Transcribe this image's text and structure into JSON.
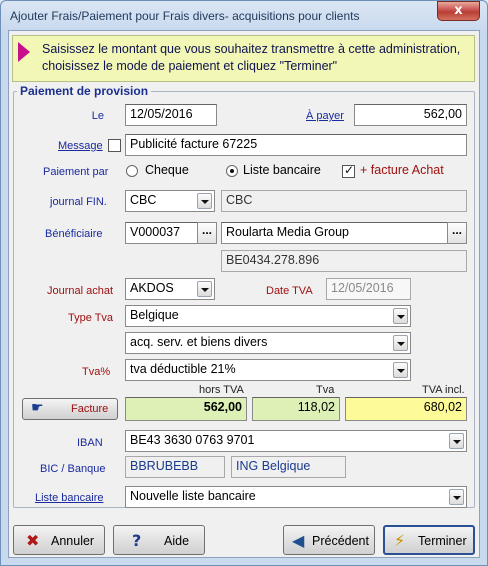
{
  "window": {
    "title": "Ajouter Frais/Paiement pour Frais divers- acquisitions pour clients",
    "close_glyph": "x"
  },
  "banner": {
    "text": "Saisissez le montant que vous souhaitez transmettre à cette administration, choisissez le mode de paiement et cliquez \"Terminer\""
  },
  "group": {
    "title": "Paiement de provision"
  },
  "form": {
    "le_label": "Le",
    "le_value": "12/05/2016",
    "a_payer_label": "À payer",
    "a_payer_value": "562,00",
    "message_label": "Message",
    "message_checked": false,
    "message_value": "Publicité facture 67225",
    "paiement_par_label": "Paiement par",
    "paiement_options": [
      "Cheque",
      "Liste bancaire"
    ],
    "paiement_selected": "Liste bancaire",
    "facture_achat_label": "+ facture Achat",
    "facture_achat_checked": true,
    "journal_fin_label": "journal FIN.",
    "journal_fin_value": "CBC",
    "journal_fin_desc": "CBC",
    "beneficiaire_label": "Bénéficiaire",
    "beneficiaire_code": "V000037",
    "beneficiaire_name": "Roularta Media Group",
    "beneficiaire_vat": "BE0434.278.896",
    "journal_achat_label": "Journal achat",
    "journal_achat_value": "AKDOS",
    "date_tva_label": "Date TVA",
    "date_tva_value": "12/05/2016",
    "type_tva_label": "Type Tva",
    "type_tva_value": "Belgique",
    "type_tva_sub_value": "acq. serv. et biens divers",
    "tva_pct_label": "Tva%",
    "tva_pct_value": "tva déductible 21%",
    "facture_button_label": "Facture",
    "hors_tva_label": "hors TVA",
    "tva_label": "Tva",
    "tva_incl_label": "TVA incl.",
    "hors_tva_value": "562,00",
    "tva_value": "118,02",
    "tva_incl_value": "680,02",
    "iban_label": "IBAN",
    "iban_value": "BE43 3630 0763 9701",
    "bic_label": "BIC / Banque",
    "bic_value": "BBRUBEBB",
    "banque_value": "ING Belgique",
    "liste_bancaire_label": "Liste bancaire",
    "liste_bancaire_value": "Nouvelle liste bancaire"
  },
  "buttons": {
    "annuler": "Annuler",
    "aide": "Aide",
    "precedent": "Précédent",
    "terminer": "Terminer"
  },
  "colors": {
    "label_blue": "#1a2aa0",
    "label_red": "#a01010",
    "banner_bg": "#f2f7b5",
    "banner_arrow": "#c8108a",
    "amount_green": "#ddf1b6",
    "amount_yellow": "#fdfb97"
  },
  "icons": {
    "annuler": "cross-icon",
    "aide": "question-icon",
    "precedent": "arrow-left-icon",
    "terminer": "lightning-icon",
    "facture": "hand-pointer-icon"
  }
}
